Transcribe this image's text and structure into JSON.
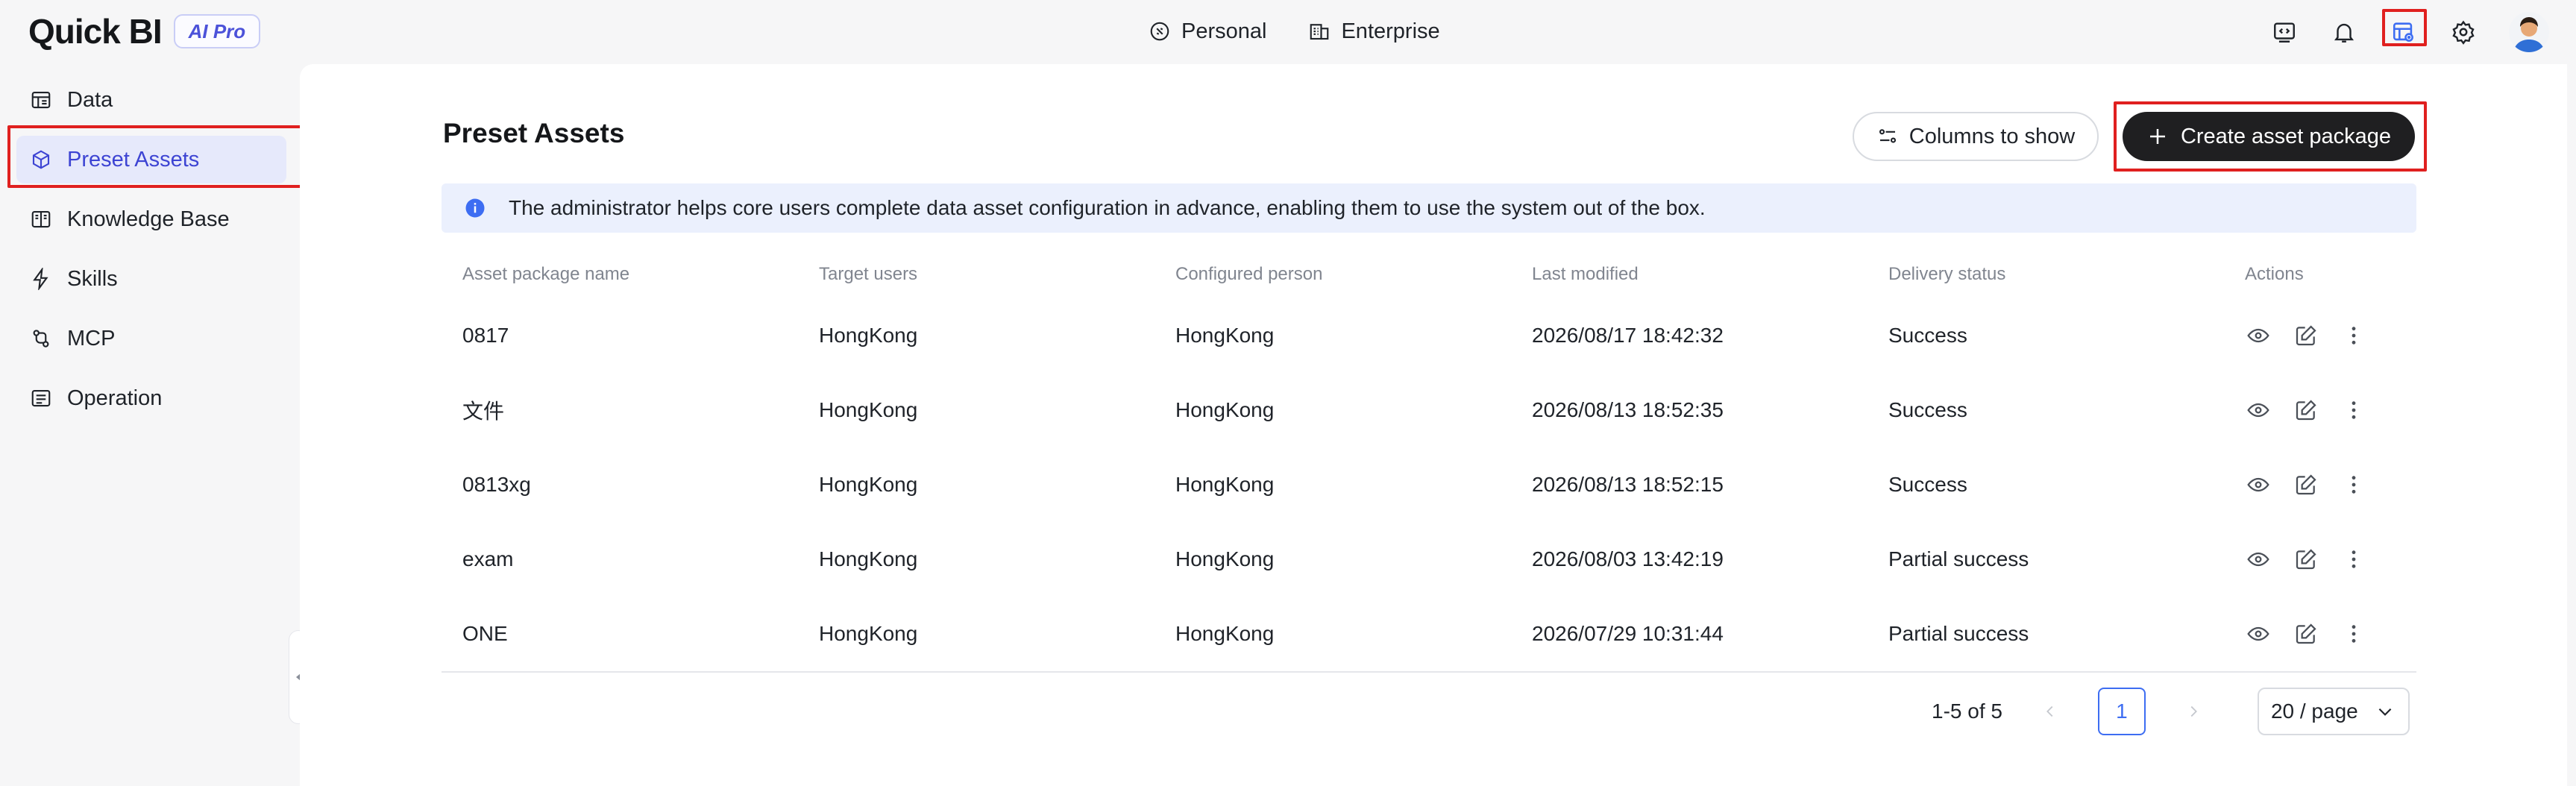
{
  "brand": {
    "name": "Quick BI",
    "badge": "AI Pro"
  },
  "modes": [
    {
      "label": "Personal",
      "icon": "personal-icon"
    },
    {
      "label": "Enterprise",
      "icon": "enterprise-icon"
    }
  ],
  "top_icons": [
    "code-icon",
    "bell-icon",
    "asset-manage-icon",
    "gear-icon"
  ],
  "sidebar": {
    "items": [
      {
        "label": "Data",
        "icon": "data-icon"
      },
      {
        "label": "Preset Assets",
        "icon": "cube-icon"
      },
      {
        "label": "Knowledge Base",
        "icon": "book-icon"
      },
      {
        "label": "Skills",
        "icon": "lightning-icon"
      },
      {
        "label": "MCP",
        "icon": "mcp-icon"
      },
      {
        "label": "Operation",
        "icon": "operation-icon"
      }
    ]
  },
  "page": {
    "title": "Preset Assets",
    "columns_button": "Columns to show",
    "create_button": "Create asset package",
    "info": "The administrator helps core users complete data asset configuration in advance, enabling them to use the system out of the box."
  },
  "table": {
    "columns": [
      "Asset package name",
      "Target users",
      "Configured person",
      "Last modified",
      "Delivery status",
      "Actions"
    ],
    "rows": [
      [
        "0817",
        "HongKong",
        "HongKong",
        "2026/08/17 18:42:32",
        "Success"
      ],
      [
        "文件",
        "HongKong",
        "HongKong",
        "2026/08/13 18:52:35",
        "Success"
      ],
      [
        "0813xg",
        "HongKong",
        "HongKong",
        "2026/08/13 18:52:15",
        "Success"
      ],
      [
        "exam",
        "HongKong",
        "HongKong",
        "2026/08/03 13:42:19",
        "Partial success"
      ],
      [
        "ONE",
        "HongKong",
        "HongKong",
        "2026/07/29 10:31:44",
        "Partial success"
      ]
    ]
  },
  "pagination": {
    "total": "1-5 of 5",
    "current": "1",
    "page_size": "20 / page"
  },
  "colors": {
    "accent": "#3d44d3",
    "highlight": "#e0201f",
    "primary_button": "#1f1f21",
    "info_bg": "#ebf0fd"
  }
}
